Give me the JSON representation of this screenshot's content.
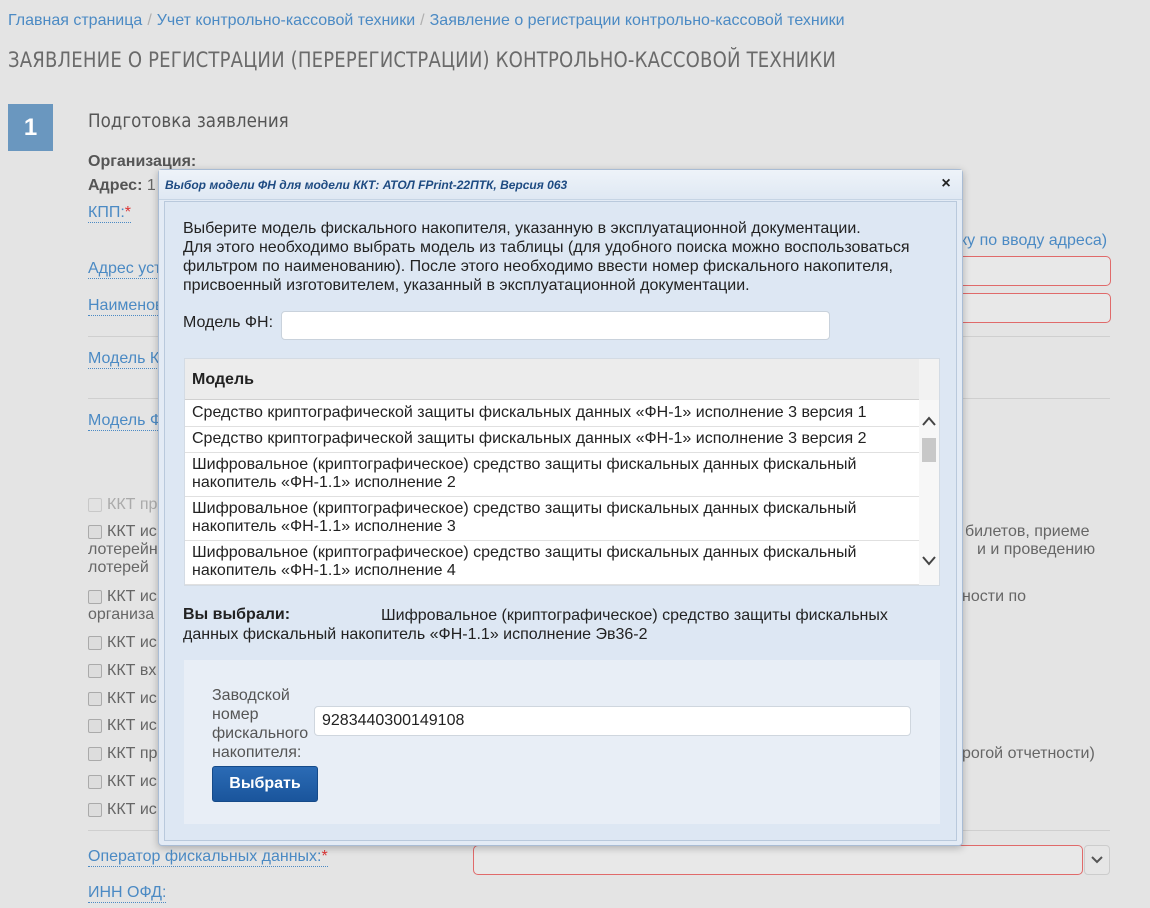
{
  "breadcrumb": [
    "Главная страница",
    "Учет контрольно-кассовой техники",
    "Заявление о регистрации контрольно-кассовой техники"
  ],
  "page_title": "ЗАЯВЛЕНИЕ О РЕГИСТРАЦИИ (ПЕРЕРЕГИСТРАЦИИ) КОНТРОЛЬНО-КАССОВОЙ ТЕХНИКИ",
  "step": {
    "number": "1",
    "title": "Подготовка заявления"
  },
  "background": {
    "org_label": "Организация:",
    "address_label": "Адрес:",
    "address_value_partial": "1",
    "kpp_label": "КПП:",
    "required_mark": "*",
    "address_link_partial": "Адрес уст",
    "name_link_partial": "Наименов",
    "model_kkt_partial": "Модель К",
    "model_fn_partial": "Модель Ф",
    "address_help_partial": "ку по вводу адреса)",
    "checkboxes": [
      {
        "label": "ККТ пр",
        "disabled": true
      },
      {
        "label": "ККТ ис",
        "disabled": false
      },
      {
        "label": "ККТ ис",
        "disabled": false
      },
      {
        "label": "ККТ ис",
        "disabled": false
      },
      {
        "label": "ККТ вх",
        "disabled": false
      },
      {
        "label": "ККТ ис",
        "disabled": false
      },
      {
        "label": "ККТ ис",
        "disabled": false
      },
      {
        "label": "ККТ пр",
        "disabled": false
      },
      {
        "label": "ККТ ис",
        "disabled": false
      },
      {
        "label": "ККТ ис",
        "disabled": false
      }
    ],
    "cb2_line2": "лотерейн",
    "cb2_line3": "лотерей",
    "cb2_right_line1": "билетов, приеме",
    "cb2_right_line2": "и и проведению",
    "cb3_line2": "организа",
    "cb3_right": "ности по",
    "cb8_right": "рогой отчетности)",
    "ofd_label": "Оператор фискальных данных:",
    "inn_ofd_label": "ИНН ОФД:"
  },
  "modal": {
    "title": "Выбор модели ФН для модели ККТ: АТОЛ FPrint-22ПТК, Версия 063",
    "close_label": "×",
    "instructions_line1": "Выберите модель фискального накопителя, указанную в эксплуатационной документации.",
    "instructions_line2": "Для этого необходимо выбрать модель из таблицы (для удобного поиска можно воспользоваться фильтром по наименованию). После этого необходимо ввести номер фискального накопителя, присвоенный изготовителем, указанный в эксплуатационной документации.",
    "filter_label": "Модель ФН:",
    "filter_value": "",
    "table_header": "Модель",
    "rows": [
      "Средство криптографической защиты фискальных данных «ФН-1» исполнение 3 версия 1",
      "Средство криптографической защиты фискальных данных «ФН-1» исполнение 3 версия 2",
      "Шифровальное (криптографическое) средство защиты фискальных данных фискальный накопитель «ФН-1.1» исполнение 2",
      "Шифровальное (криптографическое) средство защиты фискальных данных фискальный накопитель «ФН-1.1» исполнение 3",
      "Шифровальное (криптографическое) средство защиты фискальных данных фискальный накопитель «ФН-1.1» исполнение 4"
    ],
    "chosen_label": "Вы выбрали:",
    "chosen_value": "Шифровальное (криптографическое) средство защиты фискальных данных фискальный накопитель «ФН-1.1» исполнение Эв36-2",
    "serial_label": "Заводской номер фискального накопителя:",
    "serial_value": "9283440300149108",
    "select_button": "Выбрать"
  },
  "colors": {
    "link": "#4b8ac4",
    "step_badge": "#6a97bf",
    "modal_title": "#1e4b82",
    "primary_button": "#1a559c",
    "error_border": "#e06a6a"
  }
}
